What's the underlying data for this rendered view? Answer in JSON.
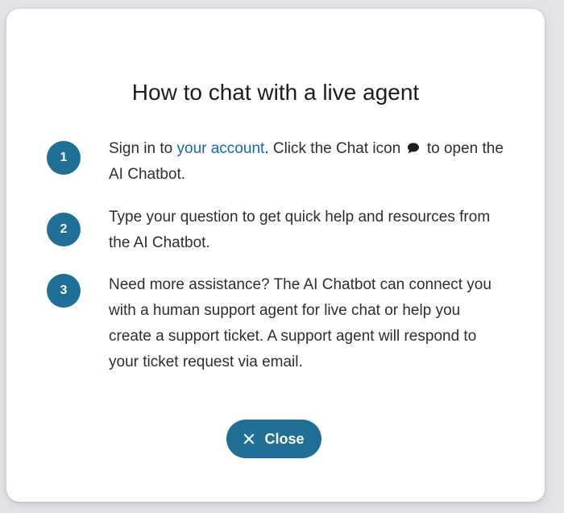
{
  "dialog": {
    "title": "How to chat with a live agent",
    "steps": [
      {
        "number": "1",
        "text_before_link": "Sign in to ",
        "link_text": "your account",
        "text_after_link": ". Click the Chat icon",
        "text_end": " to open the AI Chatbot."
      },
      {
        "number": "2",
        "text": "Type your question to get quick help and resources from the AI Chatbot."
      },
      {
        "number": "3",
        "text": "Need more assistance? The AI Chatbot can connect you with a human support agent for live chat or help you create a support ticket. A support agent will respond to your ticket request via email."
      }
    ],
    "close_label": "Close",
    "icons": {
      "chat": "chat-bubble-icon",
      "close": "close-icon"
    }
  },
  "colors": {
    "accent": "#1f6f96",
    "link": "#1565c0",
    "background": "#e3e5e8",
    "card": "#ffffff",
    "text": "#2b2e33"
  }
}
